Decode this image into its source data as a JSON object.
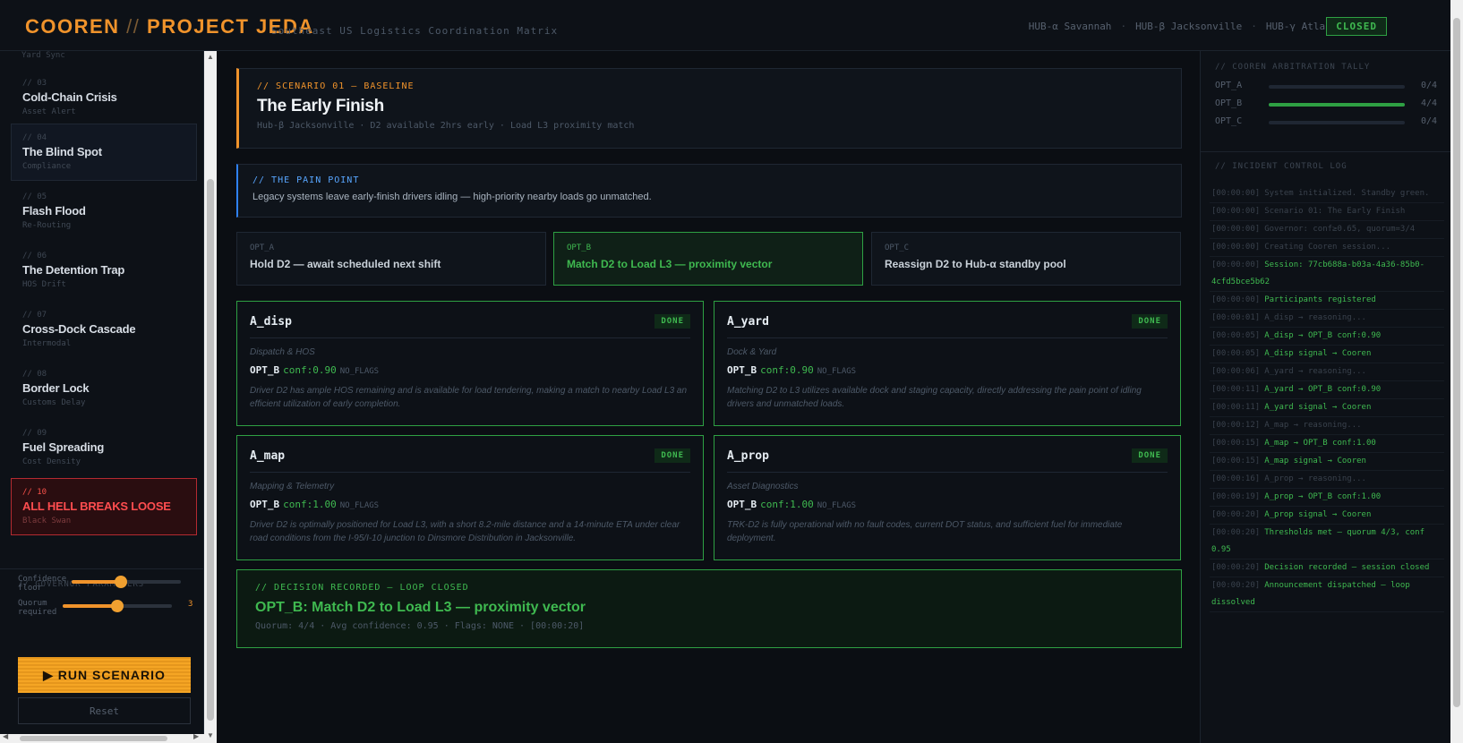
{
  "header": {
    "brand_a": "COOREN",
    "brand_sep": " // ",
    "brand_b": "PROJECT JEDA",
    "subtitle": "Southeast US Logistics Coordination Matrix",
    "hubs": [
      "HUB-α Savannah",
      "HUB-β Jacksonville",
      "HUB-γ Atlanta"
    ],
    "hub_sep": "·",
    "status": "CLOSED"
  },
  "sidebar": {
    "cut_label": "Yard Sync",
    "scenarios": [
      {
        "num": "// 03",
        "title": "Cold-Chain Crisis",
        "sub": "Asset Alert"
      },
      {
        "num": "// 04",
        "title": "The Blind Spot",
        "sub": "Compliance"
      },
      {
        "num": "// 05",
        "title": "Flash Flood",
        "sub": "Re-Routing"
      },
      {
        "num": "// 06",
        "title": "The Detention Trap",
        "sub": "HOS Drift"
      },
      {
        "num": "// 07",
        "title": "Cross-Dock Cascade",
        "sub": "Intermodal"
      },
      {
        "num": "// 08",
        "title": "Border Lock",
        "sub": "Customs Delay"
      },
      {
        "num": "// 09",
        "title": "Fuel Spreading",
        "sub": "Cost Density"
      },
      {
        "num": "// 10",
        "title": "ALL HELL BREAKS LOOSE",
        "sub": "Black Swan"
      }
    ],
    "governor": {
      "heading": "// GOVERNOR PARAMETERS",
      "confidence_label": "Confidence floor",
      "confidence_fraction": 0.45,
      "quorum_label": "Quorum required",
      "quorum_fraction": 0.5,
      "quorum_value": "3"
    },
    "run_label": "▶ RUN SCENARIO",
    "reset_label": "Reset"
  },
  "scenario": {
    "tag": "// SCENARIO 01 — BASELINE",
    "title": "The Early Finish",
    "meta": "Hub-β Jacksonville · D2 available 2hrs early · Load L3 proximity match"
  },
  "pain": {
    "heading": "// THE PAIN POINT",
    "text": "Legacy systems leave early-finish drivers idling — high-priority nearby loads go unmatched."
  },
  "options": [
    {
      "id": "OPT_A",
      "text": "Hold D2 — await scheduled next shift"
    },
    {
      "id": "OPT_B",
      "text": "Match D2 to Load L3 — proximity vector"
    },
    {
      "id": "OPT_C",
      "text": "Reassign D2 to Hub-α standby pool"
    }
  ],
  "agents": [
    {
      "name": "A_disp",
      "status": "DONE",
      "role": "Dispatch & HOS",
      "opt": "OPT_B",
      "conf": "conf:0.90",
      "flags": "NO_FLAGS",
      "text": "Driver D2 has ample HOS remaining and is available for load tendering, making a match to nearby Load L3 an efficient utilization of early completion."
    },
    {
      "name": "A_yard",
      "status": "DONE",
      "role": "Dock & Yard",
      "opt": "OPT_B",
      "conf": "conf:0.90",
      "flags": "NO_FLAGS",
      "text": "Matching D2 to L3 utilizes available dock and staging capacity, directly addressing the pain point of idling drivers and unmatched loads."
    },
    {
      "name": "A_map",
      "status": "DONE",
      "role": "Mapping & Telemetry",
      "opt": "OPT_B",
      "conf": "conf:1.00",
      "flags": "NO_FLAGS",
      "text": "Driver D2 is optimally positioned for Load L3, with a short 8.2-mile distance and a 14-minute ETA under clear road conditions from the I-95/I-10 junction to Dinsmore Distribution in Jacksonville."
    },
    {
      "name": "A_prop",
      "status": "DONE",
      "role": "Asset Diagnostics",
      "opt": "OPT_B",
      "conf": "conf:1.00",
      "flags": "NO_FLAGS",
      "text": "TRK-D2 is fully operational with no fault codes, current DOT status, and sufficient fuel for immediate deployment."
    }
  ],
  "decision": {
    "heading": "// DECISION RECORDED — LOOP CLOSED",
    "title": "OPT_B: Match D2 to Load L3 — proximity vector",
    "meta": "Quorum: 4/4 · Avg confidence: 0.95 · Flags: NONE · [00:00:20]"
  },
  "tally": {
    "heading": "// COOREN ARBITRATION TALLY",
    "rows": [
      {
        "label": "OPT_A",
        "count": "0/4",
        "fraction": 0
      },
      {
        "label": "OPT_B",
        "count": "4/4",
        "fraction": 1
      },
      {
        "label": "OPT_C",
        "count": "0/4",
        "fraction": 0
      }
    ]
  },
  "log": {
    "heading": "// INCIDENT CONTROL LOG",
    "entries": [
      {
        "ts": "[00:00:00]",
        "msg": "System initialized. Standby green.",
        "kind": "dim"
      },
      {
        "ts": "[00:00:00]",
        "msg": "Scenario 01: The Early Finish",
        "kind": "dim"
      },
      {
        "ts": "[00:00:00]",
        "msg": "Governor: conf≥0.65, quorum=3/4",
        "kind": "dim"
      },
      {
        "ts": "[00:00:00]",
        "msg": "Creating Cooren session...",
        "kind": "dim"
      },
      {
        "ts": "[00:00:00]",
        "msg": "Session: 77cb688a-b03a-4a36-85b0-4cfd5bce5b62",
        "kind": "ok"
      },
      {
        "ts": "[00:00:00]",
        "msg": "Participants registered",
        "kind": "ok"
      },
      {
        "ts": "[00:00:01]",
        "msg": "A_disp → reasoning...",
        "kind": "dim"
      },
      {
        "ts": "[00:00:05]",
        "msg": "A_disp → OPT_B conf:0.90",
        "kind": "ok"
      },
      {
        "ts": "[00:00:05]",
        "msg": "A_disp signal → Cooren",
        "kind": "ok"
      },
      {
        "ts": "[00:00:06]",
        "msg": "A_yard → reasoning...",
        "kind": "dim"
      },
      {
        "ts": "[00:00:11]",
        "msg": "A_yard → OPT_B conf:0.90",
        "kind": "ok"
      },
      {
        "ts": "[00:00:11]",
        "msg": "A_yard signal → Cooren",
        "kind": "ok"
      },
      {
        "ts": "[00:00:12]",
        "msg": "A_map → reasoning...",
        "kind": "dim"
      },
      {
        "ts": "[00:00:15]",
        "msg": "A_map → OPT_B conf:1.00",
        "kind": "ok"
      },
      {
        "ts": "[00:00:15]",
        "msg": "A_map signal → Cooren",
        "kind": "ok"
      },
      {
        "ts": "[00:00:16]",
        "msg": "A_prop → reasoning...",
        "kind": "dim"
      },
      {
        "ts": "[00:00:19]",
        "msg": "A_prop → OPT_B conf:1.00",
        "kind": "ok"
      },
      {
        "ts": "[00:00:20]",
        "msg": "A_prop signal → Cooren",
        "kind": "ok"
      },
      {
        "ts": "[00:00:20]",
        "msg": "Thresholds met — quorum 4/3, conf 0.95",
        "kind": "ok"
      },
      {
        "ts": "[00:00:20]",
        "msg": "Decision recorded — session closed",
        "kind": "ok"
      },
      {
        "ts": "[00:00:20]",
        "msg": "Announcement dispatched — loop dissolved",
        "kind": "ok"
      }
    ]
  },
  "colors": {
    "accent": "#f0932b",
    "success": "#3fb950",
    "danger": "#f85149",
    "info": "#58a6ff"
  }
}
